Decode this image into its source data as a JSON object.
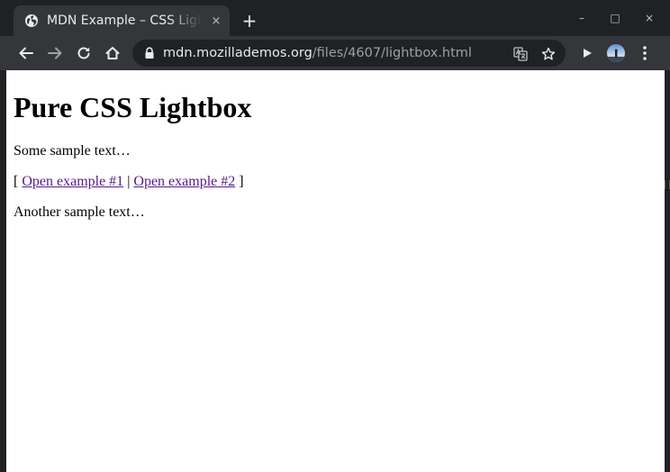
{
  "browser": {
    "tab": {
      "title": "MDN Example – CSS Lightbox",
      "close_icon": "×"
    },
    "new_tab_icon": "+",
    "window_controls": {
      "minimize": "–",
      "maximize": "□",
      "close": "×"
    },
    "address": {
      "host": "mdn.mozillademos.org",
      "path": "/files/4607/lightbox.html"
    }
  },
  "page": {
    "heading": "Pure CSS Lightbox",
    "para1": "Some sample text…",
    "links_prefix": "[ ",
    "link1": "Open example #1",
    "separator": " | ",
    "link2": "Open example #2",
    "links_suffix": " ]",
    "para3": "Another sample text…"
  },
  "colors": {
    "tab_strip": "#202124",
    "toolbar": "#35363a",
    "omnibox": "#202124",
    "link_visited": "#551a8b"
  }
}
